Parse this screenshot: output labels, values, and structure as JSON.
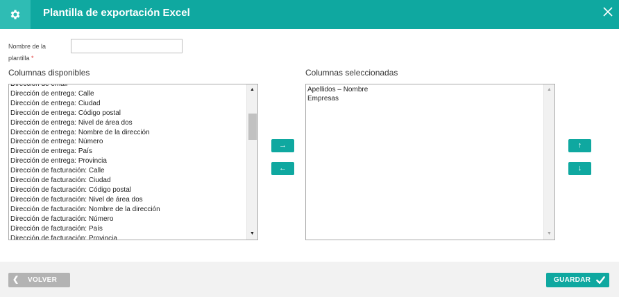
{
  "header": {
    "title": "Plantilla de exportación Excel",
    "icon": "gear-icon",
    "close_icon": "close-icon",
    "color": "#0fa8a0"
  },
  "form": {
    "name_label": "Nombre de la plantilla",
    "required_mark": "*",
    "name_value": ""
  },
  "available": {
    "title": "Columnas disponibles",
    "items": [
      "Dirección de email",
      "Dirección de entrega: Calle",
      "Dirección de entrega: Ciudad",
      "Dirección de entrega: Código postal",
      "Dirección de entrega: Nivel de área dos",
      "Dirección de entrega: Nombre de la dirección",
      "Dirección de entrega: Número",
      "Dirección de entrega: País",
      "Dirección de entrega: Provincia",
      "Dirección de facturación: Calle",
      "Dirección de facturación: Ciudad",
      "Dirección de facturación: Código postal",
      "Dirección de facturación: Nivel de área dos",
      "Dirección de facturación: Nombre de la dirección",
      "Dirección de facturación: Número",
      "Dirección de facturación: País",
      "Dirección de facturación: Provincia"
    ]
  },
  "selected": {
    "title": "Columnas seleccionadas",
    "items": [
      "Apellidos – Nombre",
      "Empresas"
    ]
  },
  "buttons": {
    "add": "→",
    "remove": "←",
    "up": "↑",
    "down": "↓",
    "back": "VOLVER",
    "save": "GUARDAR"
  }
}
